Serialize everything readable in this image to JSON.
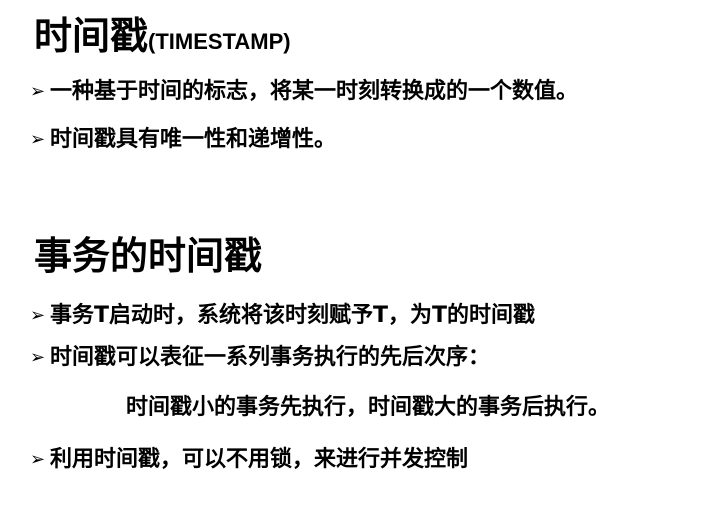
{
  "section1": {
    "title": "时间戳",
    "title_suffix": "(TIMESTAMP)",
    "bullets": [
      "一种基于时间的标志，将某一时刻转换成的一个数值。",
      "时间戳具有唯一性和递增性。"
    ]
  },
  "section2": {
    "title": "事务的时间戳",
    "bullets": [
      "事务T启动时，系统将该时刻赋予T，为T的时间戳",
      "时间戳可以表征一系列事务执行的先后次序："
    ],
    "sub_line": "时间戳小的事务先执行，时间戳大的事务后执行。",
    "last_bullet": "利用时间戳，可以不用锁，来进行并发控制"
  },
  "bullet_marker": "➢"
}
